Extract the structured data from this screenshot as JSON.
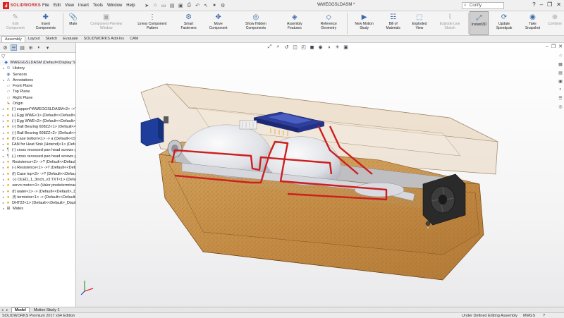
{
  "titlebar": {
    "brand": "SOLIDWORKS",
    "menus": [
      "File",
      "Edit",
      "View",
      "Insert",
      "Tools",
      "Window",
      "Help"
    ],
    "document_title": "WWEGGSLDASM *",
    "search_text": "Confly"
  },
  "commands": [
    {
      "label": "Edit Component",
      "disabled": true,
      "icon": "✎"
    },
    {
      "label": "Insert Components",
      "disabled": false,
      "icon": "✚"
    },
    {
      "label": "Mate",
      "disabled": false,
      "icon": "📎"
    },
    {
      "label": "Component Preview Window",
      "disabled": true,
      "icon": "▣"
    },
    {
      "label": "Linear Component Pattern",
      "disabled": false,
      "icon": "⋮"
    },
    {
      "label": "Smart Fasteners",
      "disabled": false,
      "icon": "⚙"
    },
    {
      "label": "Move Component",
      "disabled": false,
      "icon": "✥"
    },
    {
      "label": "Show Hidden Components",
      "disabled": false,
      "icon": "◎"
    },
    {
      "label": "Assembly Features",
      "disabled": false,
      "icon": "◈"
    },
    {
      "label": "Reference Geometry",
      "disabled": false,
      "icon": "◇"
    },
    {
      "label": "New Motion Study",
      "disabled": false,
      "icon": "▶"
    },
    {
      "label": "Bill of Materials",
      "disabled": false,
      "icon": "☷"
    },
    {
      "label": "Exploded View",
      "disabled": false,
      "icon": "⬚"
    },
    {
      "label": "Explode Line Sketch",
      "disabled": true,
      "icon": "⌇"
    },
    {
      "label": "Instant3D",
      "disabled": false,
      "selected": true,
      "icon": "⤢"
    },
    {
      "label": "Update Speedpak",
      "disabled": false,
      "icon": "⟳"
    },
    {
      "label": "Take Snapshot",
      "disabled": false,
      "icon": "◉"
    },
    {
      "label": "Combine",
      "disabled": true,
      "icon": "⊕"
    }
  ],
  "tabs": [
    "Assembly",
    "Layout",
    "Sketch",
    "Evaluate",
    "SOLIDWORKS Add-Ins",
    "CAM"
  ],
  "tree": [
    {
      "label": "WWEGGSLDASM  (Default<Display State-1",
      "icon": "ti-asm",
      "glyph": "◆",
      "exp": ""
    },
    {
      "label": "History",
      "icon": "ti-folder",
      "glyph": "⏲",
      "exp": "▸"
    },
    {
      "label": "Sensors",
      "icon": "ti-folder",
      "glyph": "◉",
      "exp": ""
    },
    {
      "label": "Annotations",
      "icon": "ti-folder",
      "glyph": "A",
      "exp": "▸"
    },
    {
      "label": "Front Plane",
      "icon": "ti-plane",
      "glyph": "▱",
      "exp": ""
    },
    {
      "label": "Top Plane",
      "icon": "ti-plane",
      "glyph": "▱",
      "exp": ""
    },
    {
      "label": "Right Plane",
      "icon": "ti-plane",
      "glyph": "▱",
      "exp": ""
    },
    {
      "label": "Origin",
      "icon": "ti-origin",
      "glyph": "↳",
      "exp": ""
    },
    {
      "label": "(-) support^WWEGGSLDASM<2> ->? (D",
      "icon": "ti-part",
      "glyph": "●",
      "exp": "▸"
    },
    {
      "label": "(-) Egg WWE<1> (Default<<Default>_D",
      "icon": "ti-part",
      "glyph": "●",
      "exp": "▸"
    },
    {
      "label": "(-) Egg WWE<2> (Default<<Default>_D",
      "icon": "ti-part",
      "glyph": "●",
      "exp": "▸"
    },
    {
      "label": "(-) Ball Bearing 608ZZ<1> (Default<<D",
      "icon": "ti-part",
      "glyph": "●",
      "exp": "▸"
    },
    {
      "label": "(-) Ball Bearing 608ZZ<2> (Default<<D",
      "icon": "ti-part",
      "glyph": "●",
      "exp": "▸"
    },
    {
      "label": "(f) Case bottom<1> -> a (Default<<Defa",
      "icon": "ti-part",
      "glyph": "●",
      "exp": "▸"
    },
    {
      "label": "FAN for Heat Sink (Hotend)<1> (Default",
      "icon": "ti-part",
      "glyph": "●",
      "exp": "▸"
    },
    {
      "label": "(-) cross recessed pan head screws gb<",
      "icon": "ti-screw",
      "glyph": "¶",
      "exp": "▸"
    },
    {
      "label": "(-) cross recessed pan head screws gb<",
      "icon": "ti-screw",
      "glyph": "¶",
      "exp": "▸"
    },
    {
      "label": "Resistence<2> ->? (Default<<Default>",
      "icon": "ti-part",
      "glyph": "●",
      "exp": "▸"
    },
    {
      "label": "(-) Resistence<1> ->? (Default<<Defaul",
      "icon": "ti-part",
      "glyph": "●",
      "exp": "▸"
    },
    {
      "label": "(f) Case top<2> ->? (Default<<Default>",
      "icon": "ti-part",
      "glyph": "●",
      "exp": "▸"
    },
    {
      "label": "(-) OLED_1_3inch_v3 TXT<1> (Defa",
      "icon": "ti-part",
      "glyph": "●",
      "exp": "▸"
    },
    {
      "label": "servo motor<1> (Valor predeterminado",
      "icon": "ti-part",
      "glyph": "●",
      "exp": "▸"
    },
    {
      "label": "(f) water<1> -> (Default<<Default>_Dis",
      "icon": "ti-part",
      "glyph": "●",
      "exp": "▸"
    },
    {
      "label": "(f) termistor<1> -> (Default<<Default>",
      "icon": "ti-part",
      "glyph": "●",
      "exp": "▸"
    },
    {
      "label": "DHT22<1> (Default<<Default>_Display",
      "icon": "ti-part",
      "glyph": "●",
      "exp": "▸"
    },
    {
      "label": "Mates",
      "icon": "ti-mate",
      "glyph": "⊞",
      "exp": "▸"
    }
  ],
  "bottom_tabs": [
    "Model",
    "Motion Study 1"
  ],
  "status": {
    "app": "SOLIDWORKS Premium 2017 x64 Edition",
    "definition": "Under Defined",
    "mode": "Editing Assembly",
    "units": "MMGS"
  },
  "colors": {
    "wood": "#c9954f",
    "wood_dark": "#8b5a25",
    "cover": "#d9c2a5",
    "pcb": "#2e3e9a",
    "wire": "#cc1f1f",
    "egg": "#e2e4e8",
    "fan": "#2a2a2a",
    "servo": "#1f3e9c"
  }
}
